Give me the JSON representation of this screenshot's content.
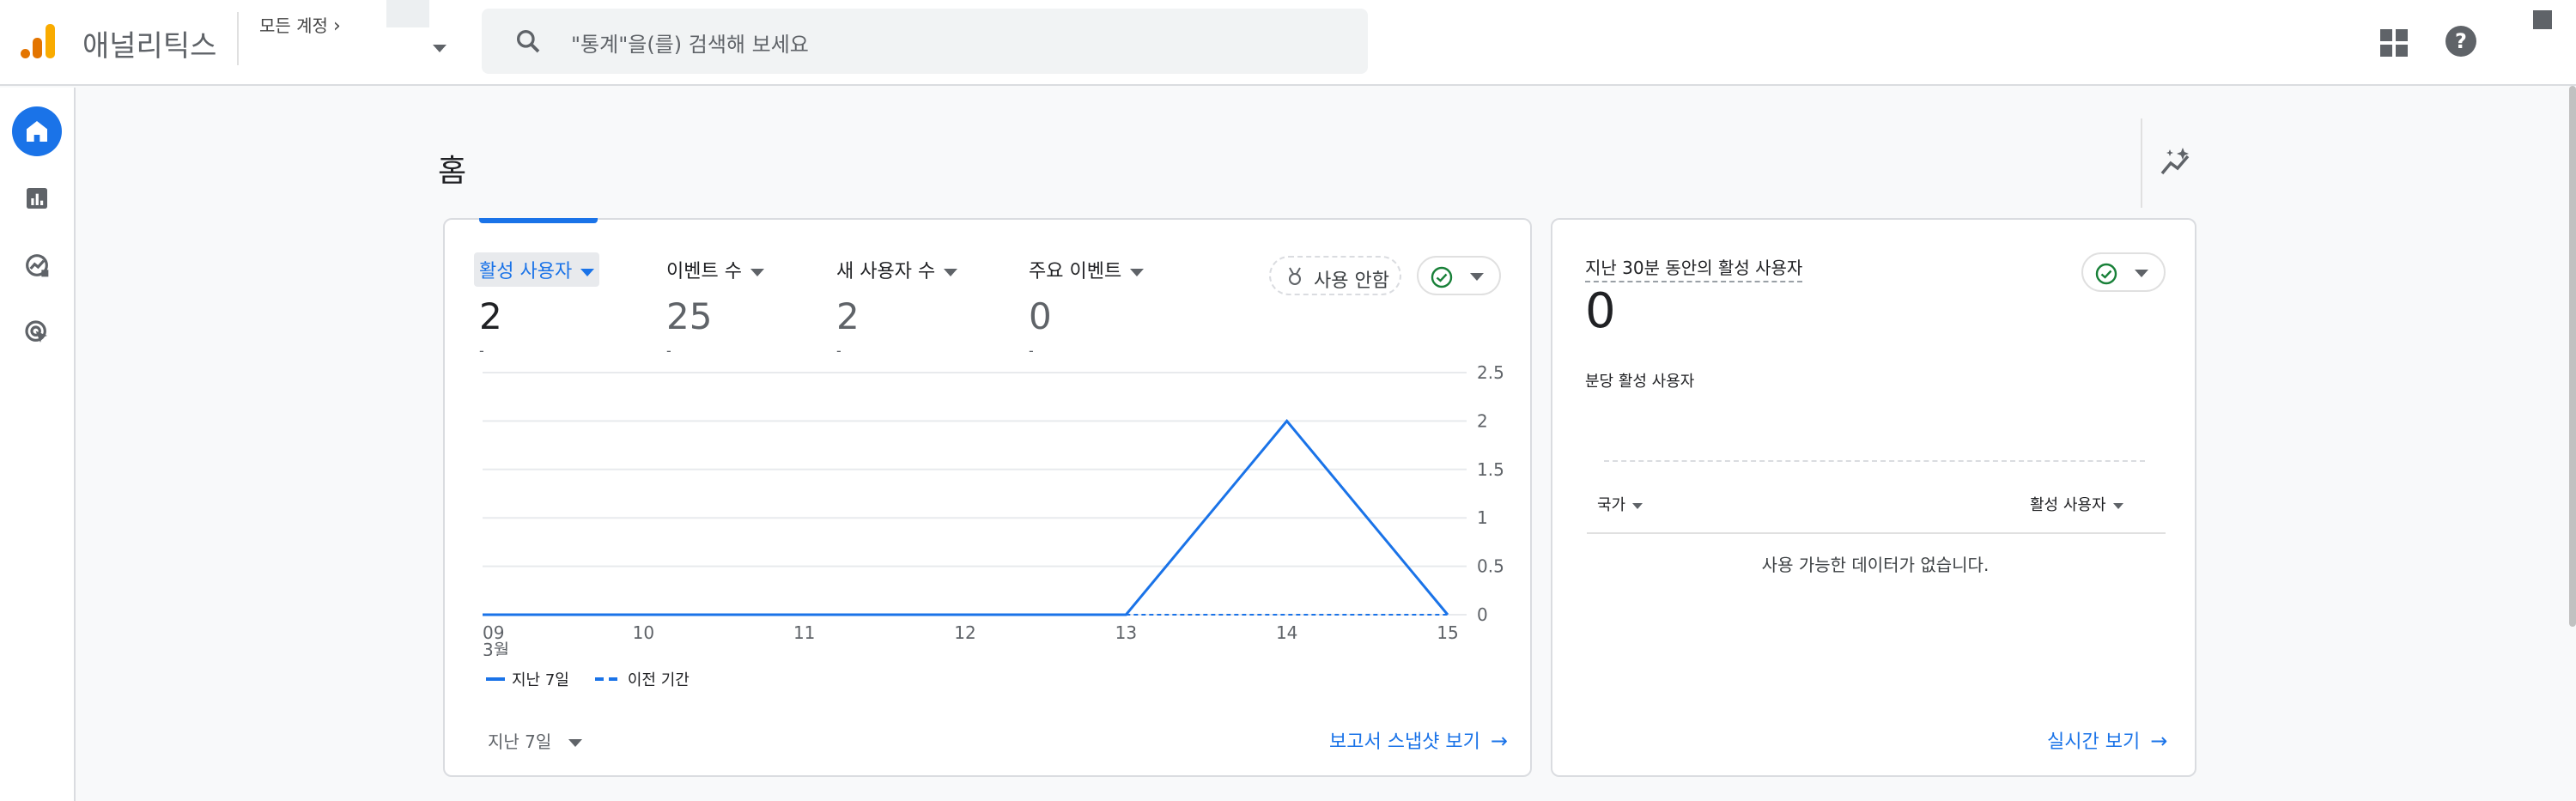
{
  "app": {
    "brand": "애널리틱스",
    "accent": "#1a73e8",
    "logo_colors": [
      "#f9ab00",
      "#e37400"
    ]
  },
  "header": {
    "account_crumb": "모든 계정",
    "search_placeholder": "\"통계\"을(를) 검색해 보세요"
  },
  "sidenav": {
    "items": [
      {
        "name": "home",
        "icon": "home-icon",
        "active": true
      },
      {
        "name": "reports",
        "icon": "bar-chart-icon",
        "active": false
      },
      {
        "name": "explore",
        "icon": "explore-icon",
        "active": false
      },
      {
        "name": "advertising",
        "icon": "ads-target-icon",
        "active": false
      }
    ]
  },
  "page": {
    "title": "홈"
  },
  "main_card": {
    "metrics": [
      {
        "label": "활성 사용자",
        "value": "2",
        "delta": "-",
        "selected": true
      },
      {
        "label": "이벤트 수",
        "value": "25",
        "delta": "-",
        "selected": false
      },
      {
        "label": "새 사용자 수",
        "value": "2",
        "delta": "-",
        "selected": false
      },
      {
        "label": "주요 이벤트",
        "value": "0",
        "delta": "-",
        "selected": false
      }
    ],
    "usage_pill": "사용 안함",
    "legend": {
      "current": "지난 7일",
      "previous": "이전 기간"
    },
    "range_select": "지난 7일",
    "snapshot_link": "보고서 스냅샷 보기"
  },
  "chart_data": {
    "type": "line",
    "x": [
      "09",
      "10",
      "11",
      "12",
      "13",
      "14",
      "15"
    ],
    "x_sublabel": "3월",
    "ylim": [
      0,
      2.5
    ],
    "yticks": [
      "2.5",
      "2",
      "1.5",
      "1",
      "0.5",
      "0"
    ],
    "grid": true,
    "legend_position": "bottom-left",
    "series": [
      {
        "name": "지난 7일",
        "values": [
          0,
          0,
          0,
          0,
          0,
          2,
          0
        ],
        "style": "solid",
        "color": "#1a73e8"
      },
      {
        "name": "이전 기간",
        "values": [
          null,
          null,
          null,
          null,
          0,
          0,
          0
        ],
        "style": "dashed",
        "color": "#1a73e8"
      }
    ]
  },
  "realtime_card": {
    "title": "지난 30분 동안의 활성 사용자",
    "value": "0",
    "subtitle": "분당 활성 사용자",
    "col_country": "국가",
    "col_active": "활성 사용자",
    "empty_message": "사용 가능한 데이터가 없습니다.",
    "realtime_link": "실시간 보기"
  }
}
